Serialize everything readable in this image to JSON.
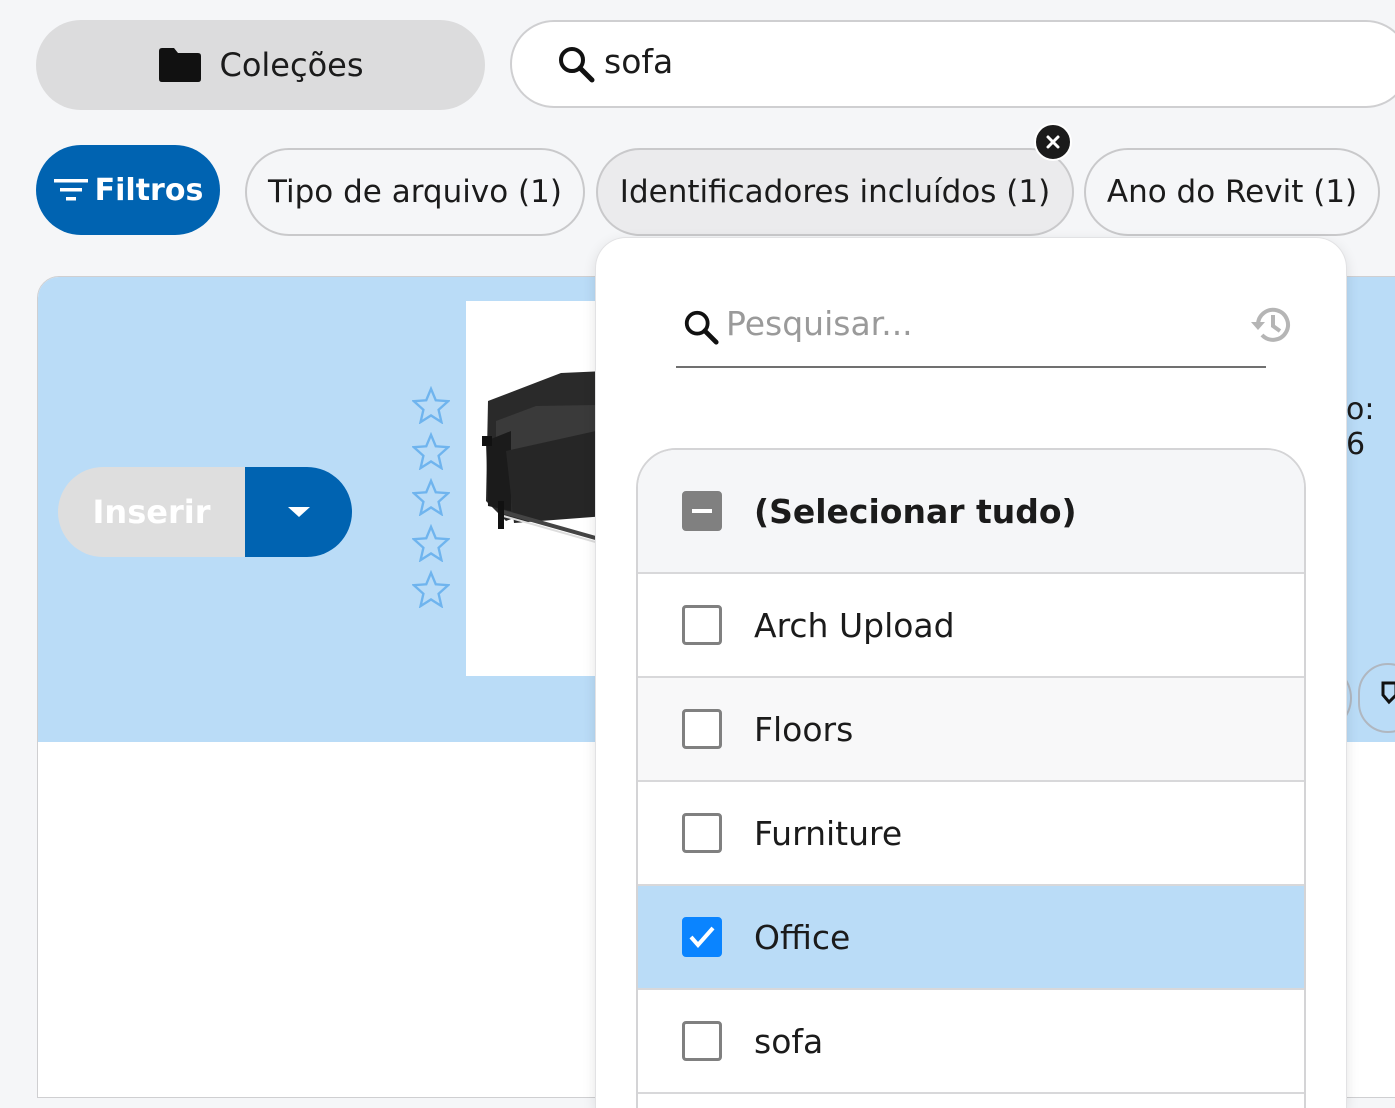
{
  "header": {
    "collections_label": "Coleções",
    "search_value": "sofa"
  },
  "filters": {
    "filters_button_label": "Filtros",
    "chips": [
      {
        "label": "Tipo de arquivo (1)"
      },
      {
        "label": "Identificadores incluídos (1)"
      },
      {
        "label": "Ano do Revit (1)"
      }
    ]
  },
  "card": {
    "insert_label": "Inserir",
    "rating_stars": 0,
    "rating_max": 5,
    "edge_text": "o: 6"
  },
  "dropdown": {
    "search_placeholder": "Pesquisar...",
    "select_all_label": "(Selecionar tudo)",
    "items": [
      {
        "label": "Arch Upload",
        "checked": false
      },
      {
        "label": "Floors",
        "checked": false
      },
      {
        "label": "Furniture",
        "checked": false
      },
      {
        "label": "Office",
        "checked": true
      },
      {
        "label": "sofa",
        "checked": false
      }
    ]
  },
  "colors": {
    "accent": "#0063b1",
    "selected_row": "#badcf7",
    "checkbox_checked": "#0a84ff"
  }
}
